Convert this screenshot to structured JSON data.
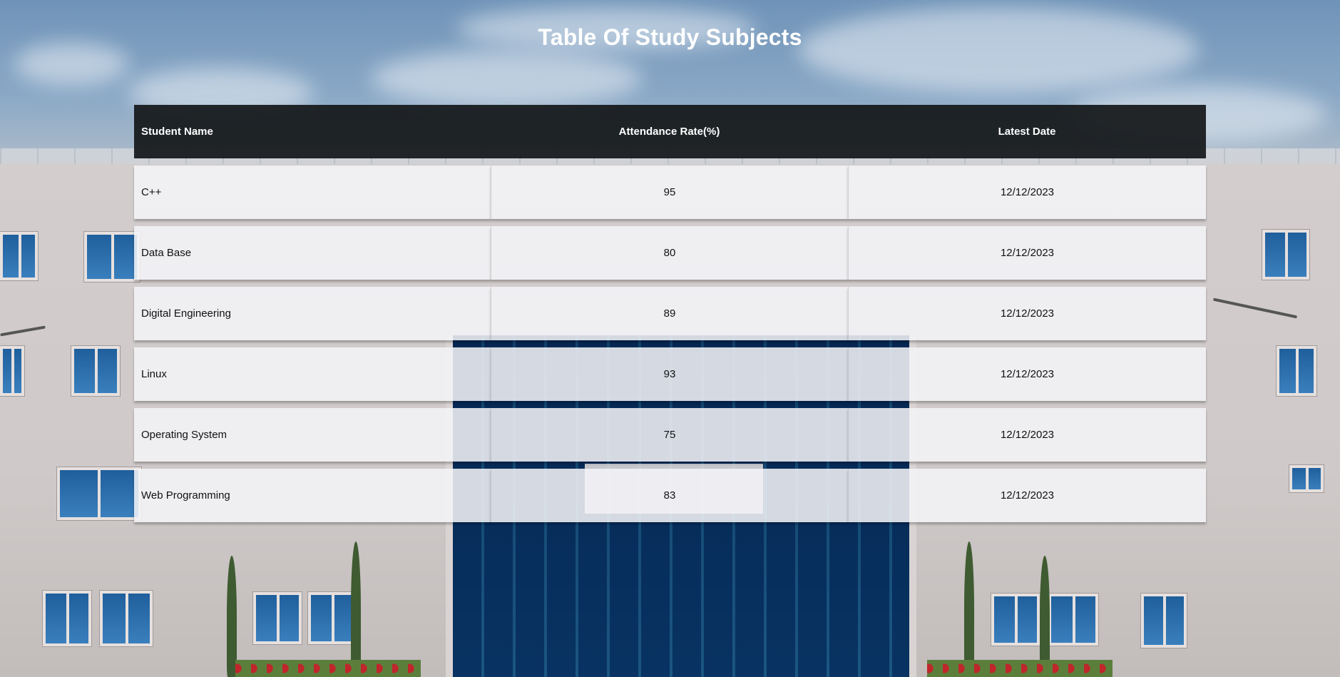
{
  "page": {
    "title": "Table Of Study Subjects",
    "background": "university-building-photo"
  },
  "table": {
    "headers": {
      "col1": "Student Name",
      "col2": "Attendance Rate(%)",
      "col3": "Latest Date"
    },
    "rows": [
      {
        "subject": "C++",
        "rate": "95",
        "date": "12/12/2023"
      },
      {
        "subject": "Data Base",
        "rate": "80",
        "date": "12/12/2023"
      },
      {
        "subject": "Digital Engineering",
        "rate": "89",
        "date": "12/12/2023"
      },
      {
        "subject": "Linux",
        "rate": "93",
        "date": "12/12/2023"
      },
      {
        "subject": "Operating System",
        "rate": "75",
        "date": "12/12/2023"
      },
      {
        "subject": "Web Programming",
        "rate": "83",
        "date": "12/12/2023"
      }
    ]
  },
  "colors": {
    "header_bg": "#14181a",
    "row_bg": "#f3f4f7",
    "title_text": "#ffffff"
  }
}
